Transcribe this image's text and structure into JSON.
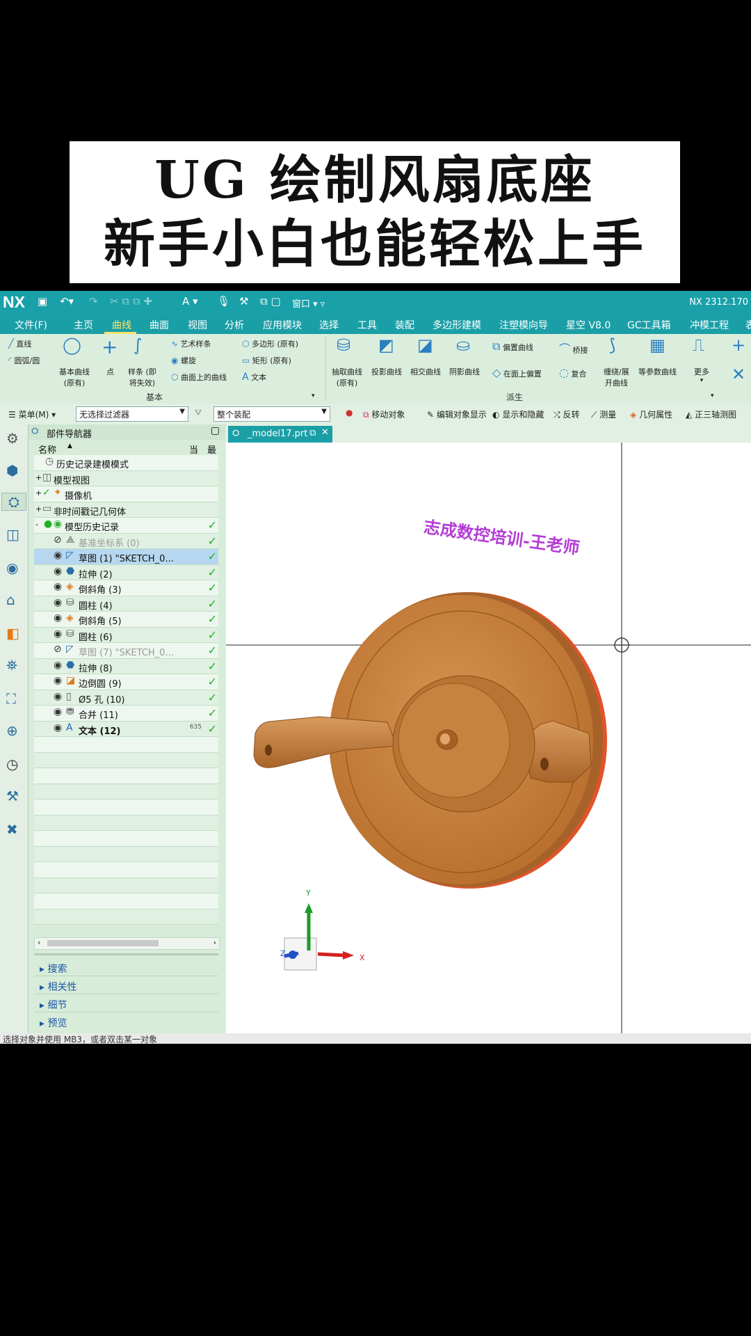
{
  "banner": {
    "line1": "UG 绘制风扇底座",
    "line2": "新手小白也能轻松上手"
  },
  "app": {
    "logo": "NX",
    "version": "NX 2312.170",
    "window_label": "窗口",
    "menu": [
      "文件(F)",
      "主页",
      "曲线",
      "曲面",
      "视图",
      "分析",
      "应用模块",
      "选择",
      "工具",
      "装配",
      "多边形建模",
      "注塑模向导",
      "星空 V8.0",
      "GC工具箱",
      "冲模工程",
      "表"
    ],
    "active_menu": "曲线",
    "ribbon": {
      "basic": {
        "line": "直线",
        "arc": "圆弧/圆",
        "basic_curve": "基本曲线",
        "basic_curve_sub": "(原有)",
        "point": "点",
        "spline": "样条 (即",
        "spline_sub": "将失效)",
        "art_spline": "艺术样条",
        "helix": "螺旋",
        "curve_on_surface": "曲面上的曲线",
        "polygon": "多边形 (原有)",
        "rectangle": "矩形 (原有)",
        "text": "文本",
        "group": "基本"
      },
      "derived": {
        "extract": "抽取曲线",
        "extract_sub": "(原有)",
        "project": "投影曲线",
        "intersect": "相交曲线",
        "isocline": "阴影曲线",
        "offset": "偏置曲线",
        "offset_in_face": "在面上偏置",
        "bridge": "桥接",
        "composite": "复合",
        "wrap": "缠绕/展",
        "wrap_sub": "开曲线",
        "iso": "等参数曲线",
        "more": "更多",
        "group": "派生"
      }
    },
    "selbar": {
      "menu": "菜单(M)",
      "filter": "无选择过滤器",
      "scope": "整个装配",
      "move": "移动对象",
      "edit_display": "编辑对象显示",
      "show_hide": "显示和隐藏",
      "invert": "反转",
      "measure": "测量",
      "geo_props": "几何属性",
      "trimetric": "正三轴测图"
    },
    "navigator": {
      "title": "部件导航器",
      "col_name": "名称",
      "col_current": "当",
      "col_latest": "最",
      "rows": [
        {
          "indent": 1,
          "label": "历史记录建模模式",
          "icon": "clock-icon",
          "check": false
        },
        {
          "indent": 0,
          "label": "模型视图",
          "icon": "view-icon",
          "expand": "+",
          "check": false
        },
        {
          "indent": 0,
          "label": "摄像机",
          "icon": "camera-icon",
          "expand": "+",
          "check": false,
          "tick": true
        },
        {
          "indent": 0,
          "label": "非时间戳记几何体",
          "icon": "folder-icon",
          "expand": "+",
          "check": false
        },
        {
          "indent": 0,
          "label": "模型历史记录",
          "icon": "history-icon",
          "expand": "-",
          "check": true
        },
        {
          "indent": 2,
          "label": "基准坐标系 (0)",
          "icon": "datum-icon",
          "gray": true,
          "check": true
        },
        {
          "indent": 2,
          "label": "草图 (1) \"SKETCH_0...",
          "icon": "sketch-icon",
          "selected": true,
          "check": true
        },
        {
          "indent": 2,
          "label": "拉伸 (2)",
          "icon": "extrude-icon",
          "check": true
        },
        {
          "indent": 2,
          "label": "倒斜角 (3)",
          "icon": "chamfer-icon",
          "check": true
        },
        {
          "indent": 2,
          "label": "圆柱 (4)",
          "icon": "cylinder-icon",
          "check": true
        },
        {
          "indent": 2,
          "label": "倒斜角 (5)",
          "icon": "chamfer-icon",
          "check": true
        },
        {
          "indent": 2,
          "label": "圆柱 (6)",
          "icon": "cylinder-icon",
          "check": true
        },
        {
          "indent": 2,
          "label": "草图 (7) \"SKETCH_0...",
          "icon": "sketch-icon",
          "gray": true,
          "check": true
        },
        {
          "indent": 2,
          "label": "拉伸 (8)",
          "icon": "extrude-icon",
          "check": true
        },
        {
          "indent": 2,
          "label": "边倒圆 (9)",
          "icon": "blend-icon",
          "check": true
        },
        {
          "indent": 2,
          "label": "Ø5 孔 (10)",
          "icon": "hole-icon",
          "check": true
        },
        {
          "indent": 2,
          "label": "合并 (11)",
          "icon": "unite-icon",
          "check": true
        },
        {
          "indent": 2,
          "label": "文本 (12)",
          "icon": "text-icon",
          "bold": true,
          "badge": "635",
          "check": true
        }
      ],
      "panels": [
        "搜索",
        "相关性",
        "细节",
        "预览"
      ]
    },
    "tab_label": "_model17.prt",
    "watermark": "志成数控培训-王老师",
    "axes": {
      "x": "X",
      "y": "Y",
      "z": "Z"
    },
    "status": "选择对象并使用 MB3，或者双击某一对象"
  },
  "colors": {
    "teal": "#1a9fa7",
    "ribbon_bg": "#dbeedd",
    "part_body": "#c9813f",
    "check_green": "#21b024",
    "watermark": "#b43cd6"
  }
}
